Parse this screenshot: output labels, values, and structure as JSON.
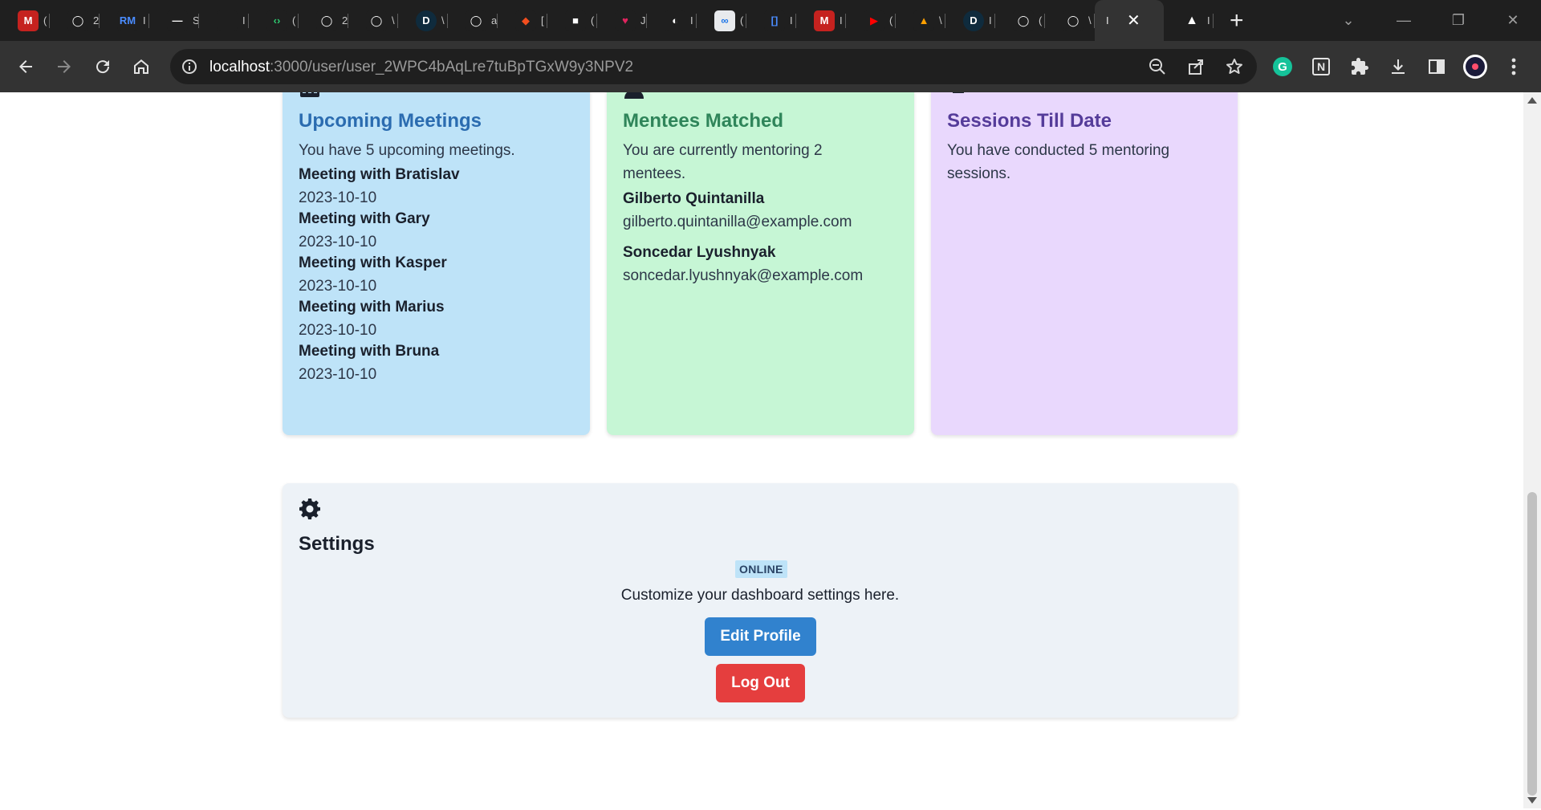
{
  "browser": {
    "tabs": [
      {
        "icon": "gmail-100-icon",
        "glyph": "M",
        "bg": "#c5221f",
        "label": "("
      },
      {
        "icon": "github-icon",
        "glyph": "◯",
        "bg": "#1f1f1f",
        "label": "2"
      },
      {
        "icon": "rm-icon",
        "glyph": "RM",
        "bg": "#1f1f1f",
        "label": "I"
      },
      {
        "icon": "dash-icon",
        "glyph": "—",
        "bg": "#1f1f1f",
        "label": "S"
      },
      {
        "icon": "blank-icon",
        "glyph": "",
        "bg": "#1f1f1f",
        "label": "I"
      },
      {
        "icon": "code-brackets-icon",
        "glyph": "‹›",
        "bg": "#1f1f1f",
        "label": "("
      },
      {
        "icon": "github-icon",
        "glyph": "◯",
        "bg": "#1f1f1f",
        "label": "2"
      },
      {
        "icon": "github-icon",
        "glyph": "◯",
        "bg": "#1f1f1f",
        "label": "\\"
      },
      {
        "icon": "dev-d-icon",
        "glyph": "D",
        "bg": "#1f1f1f",
        "label": "\\"
      },
      {
        "icon": "github-icon",
        "glyph": "◯",
        "bg": "#1f1f1f",
        "label": "a"
      },
      {
        "icon": "figma-icon",
        "glyph": "◆",
        "bg": "#1f1f1f",
        "label": "["
      },
      {
        "icon": "white-square-icon",
        "glyph": "■",
        "bg": "#1f1f1f",
        "label": "("
      },
      {
        "icon": "heart-icon",
        "glyph": "♥",
        "bg": "#1f1f1f",
        "label": "J"
      },
      {
        "icon": "globe-icon",
        "glyph": "◐",
        "bg": "#1f1f1f",
        "label": "I"
      },
      {
        "icon": "link-icon",
        "glyph": "∞",
        "bg": "#e8eaed",
        "label": "("
      },
      {
        "icon": "editor-icon",
        "glyph": "[]",
        "bg": "#1f1f1f",
        "label": "I"
      },
      {
        "icon": "gmail-100-icon",
        "glyph": "M",
        "bg": "#c5221f",
        "label": "I"
      },
      {
        "icon": "youtube-icon",
        "glyph": "▶",
        "bg": "#1f1f1f",
        "label": "("
      },
      {
        "icon": "firebase-icon",
        "glyph": "▲",
        "bg": "#1f1f1f",
        "label": "\\"
      },
      {
        "icon": "dev-d-icon",
        "glyph": "D",
        "bg": "#1f1f1f",
        "label": "I"
      },
      {
        "icon": "github-icon",
        "glyph": "◯",
        "bg": "#1f1f1f",
        "label": "("
      },
      {
        "icon": "github-icon",
        "glyph": "◯",
        "bg": "#1f1f1f",
        "label": "\\"
      }
    ],
    "active_tab": {
      "label": "I",
      "close": "✕"
    },
    "after_tab": {
      "icon": "triangle-icon",
      "glyph": "▲",
      "label": "I"
    },
    "new_tab": "+",
    "window_controls": {
      "dropdown": "⌄",
      "minimize": "—",
      "restore": "❐",
      "close": "✕"
    },
    "url": {
      "host": "localhost",
      "path": ":3000/user/user_2WPC4bAqLre7tuBpTGxW9y3NPV2"
    },
    "extensions": [
      "grammarly-icon",
      "notion-icon",
      "puzzle-icon",
      "download-icon",
      "sidebar-icon",
      "profile-avatar-icon",
      "kebab-menu-icon"
    ]
  },
  "dashboard": {
    "upcoming": {
      "title": "Upcoming Meetings",
      "description": "You have 5 upcoming meetings.",
      "bg": "#bee3f8",
      "title_color": "#2b6cb0",
      "meetings": [
        {
          "name": "Meeting with Bratislav",
          "date": "2023-10-10"
        },
        {
          "name": "Meeting with Gary",
          "date": "2023-10-10"
        },
        {
          "name": "Meeting with Kasper",
          "date": "2023-10-10"
        },
        {
          "name": "Meeting with Marius",
          "date": "2023-10-10"
        },
        {
          "name": "Meeting with Bruna",
          "date": "2023-10-10"
        }
      ]
    },
    "mentees": {
      "title": "Mentees Matched",
      "description": "You are currently mentoring 2 mentees.",
      "bg": "#c6f6d5",
      "title_color": "#2f855a",
      "list": [
        {
          "name": "Gilberto Quintanilla",
          "email": "gilberto.quintanilla@example.com"
        },
        {
          "name": "Soncedar Lyushnyak",
          "email": "soncedar.lyushnyak@example.com"
        }
      ]
    },
    "sessions": {
      "title": "Sessions Till Date",
      "description": "You have conducted 5 mentoring sessions.",
      "bg": "#e9d8fd",
      "title_color": "#553c9a"
    },
    "settings": {
      "title": "Settings",
      "status_badge": "ONLINE",
      "description": "Customize your dashboard settings here.",
      "edit_button": "Edit Profile",
      "logout_button": "Log Out"
    }
  }
}
